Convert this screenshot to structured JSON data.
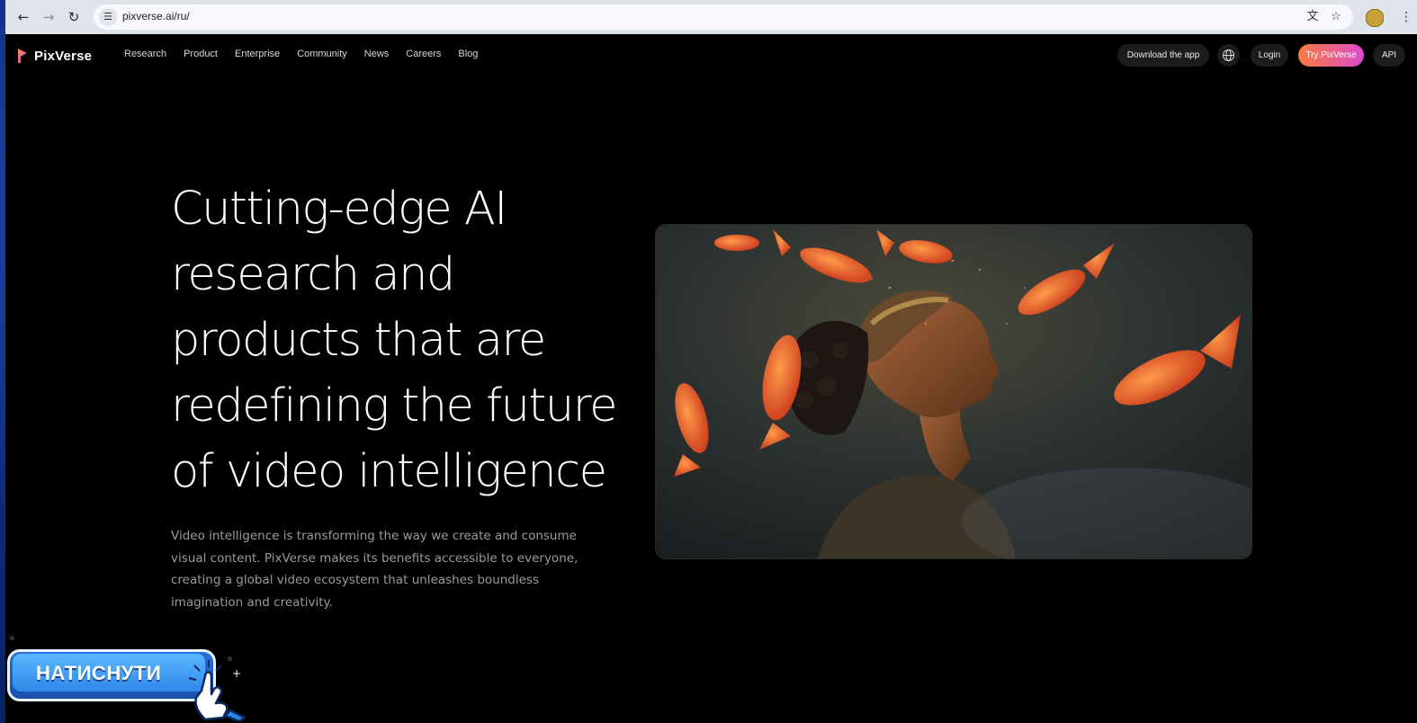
{
  "browser": {
    "url": "pixverse.ai/ru/",
    "icons": {
      "back": "back-arrow-icon",
      "forward": "forward-arrow-icon",
      "reload": "reload-icon",
      "site_info": "site-info-icon",
      "translate": "translate-icon",
      "bookmark": "star-icon",
      "profile": "profile-avatar",
      "menu": "kebab-menu-icon"
    }
  },
  "header": {
    "logo_text": "PixVerse",
    "nav": [
      "Research",
      "Product",
      "Enterprise",
      "Community",
      "News",
      "Careers",
      "Blog"
    ],
    "download_label": "Download the app",
    "login_label": "Login",
    "try_label": "Try PixVerse",
    "api_label": "API",
    "try_gradient": [
      "#ff7a3c",
      "#d94bd1"
    ]
  },
  "hero": {
    "title_lines": [
      "Cutting-edge AI",
      "research and",
      "products that are",
      "redefining the future",
      "of video intelligence"
    ],
    "subtitle_lines": [
      "Video intelligence is transforming the way we create and consume",
      "visual content. PixVerse makes its benefits accessible to everyone,",
      "creating a global video ecosystem that unleashes boundless",
      "imagination and creativity."
    ]
  },
  "overlay": {
    "button_label": "НАТИСНУТИ"
  },
  "colors": {
    "page_bg": "#000000",
    "text_primary": "#ffffff",
    "text_secondary": "#9b9b9b",
    "pill_bg": "#1c1c1c"
  }
}
